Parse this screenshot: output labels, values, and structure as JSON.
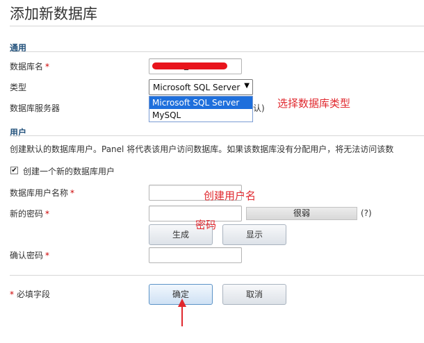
{
  "page": {
    "title": "添加新数据库"
  },
  "general": {
    "section_title": "通用",
    "db_name_label": "数据库名",
    "db_name_value": "_",
    "type_label": "类型",
    "type_selected": "Microsoft SQL Server",
    "type_options": [
      "Microsoft SQL Server",
      "MySQL"
    ],
    "server_label": "数据库服务器",
    "server_value_tail": "认)"
  },
  "users": {
    "section_title": "用户",
    "description": "创建默认的数据库用户。Panel 将代表该用户访问数据库。如果该数据库没有分配用户，将无法访问该数",
    "create_user_label": "创建一个新的数据库用户",
    "create_user_checked": true,
    "username_label": "数据库用户名称",
    "password_label": "新的密码",
    "strength_text": "很弱",
    "help_text": "(?)",
    "generate_label": "生成",
    "show_label": "显示",
    "confirm_label": "确认密码"
  },
  "footer": {
    "required_note": "必填字段",
    "ok_label": "确定",
    "cancel_label": "取消"
  },
  "annotations": {
    "select_type": "选择数据库类型",
    "create_username": "创建用户名",
    "password": "密码"
  },
  "colors": {
    "section": "#23527c",
    "required": "#cc0000",
    "annotation": "#e0282e",
    "selected_option": "#1e6fdc"
  }
}
